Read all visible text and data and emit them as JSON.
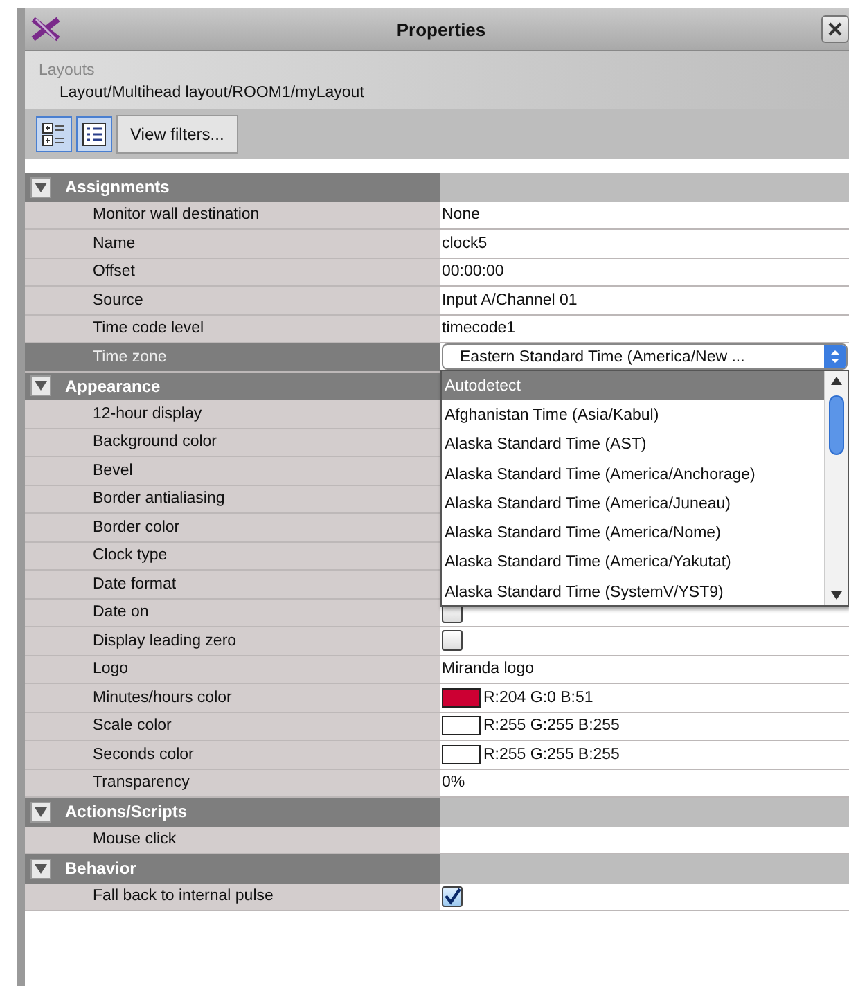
{
  "window": {
    "title": "Properties"
  },
  "location": {
    "label": "Layouts",
    "path": "Layout/Multihead layout/ROOM1/myLayout"
  },
  "toolbar": {
    "icon_buttons": [
      {
        "kind": "categorized"
      },
      {
        "kind": "list"
      }
    ],
    "filter_button": "View filters..."
  },
  "sections": [
    {
      "title": "Assignments",
      "expanded": true,
      "rows": [
        {
          "label": "Monitor wall destination",
          "kind": "text",
          "value": "None",
          "selected": false
        },
        {
          "label": "Name",
          "kind": "text",
          "value": "clock5",
          "selected": false
        },
        {
          "label": "Offset",
          "kind": "text",
          "value": "00:00:00",
          "selected": false
        },
        {
          "label": "Source",
          "kind": "text",
          "value": "Input A/Channel 01",
          "selected": false
        },
        {
          "label": "Time code level",
          "kind": "text",
          "value": "timecode1",
          "selected": false
        },
        {
          "label": "Time zone",
          "kind": "dropdown",
          "value": "Eastern Standard Time (America/New  ...",
          "selected": true,
          "open": true,
          "options": [
            {
              "label": "Autodetect",
              "selected": true
            },
            {
              "label": "Afghanistan Time (Asia/Kabul)",
              "selected": false
            },
            {
              "label": "Alaska Standard Time (AST)",
              "selected": false
            },
            {
              "label": "Alaska Standard Time (America/Anchorage)",
              "selected": false
            },
            {
              "label": "Alaska Standard Time (America/Juneau)",
              "selected": false
            },
            {
              "label": "Alaska Standard Time (America/Nome)",
              "selected": false
            },
            {
              "label": "Alaska Standard Time (America/Yakutat)",
              "selected": false
            },
            {
              "label": "Alaska Standard Time (SystemV/YST9)",
              "selected": false
            }
          ]
        }
      ]
    },
    {
      "title": "Appearance",
      "expanded": true,
      "rows": [
        {
          "label": "12-hour display",
          "kind": "hidden",
          "selected": false
        },
        {
          "label": "Background color",
          "kind": "hidden",
          "selected": false
        },
        {
          "label": "Bevel",
          "kind": "hidden",
          "selected": false
        },
        {
          "label": "Border antialiasing",
          "kind": "hidden",
          "selected": false
        },
        {
          "label": "Border color",
          "kind": "hidden",
          "selected": false
        },
        {
          "label": "Clock type",
          "kind": "hidden",
          "selected": false
        },
        {
          "label": "Date format",
          "kind": "hidden",
          "selected": false
        },
        {
          "label": "Date on",
          "kind": "checkbox",
          "checked": false,
          "selected": false
        },
        {
          "label": "Display leading zero",
          "kind": "checkbox",
          "checked": false,
          "selected": false
        },
        {
          "label": "Logo",
          "kind": "text",
          "value": "Miranda logo",
          "selected": false
        },
        {
          "label": "Minutes/hours color",
          "kind": "color",
          "color": "#cc0033",
          "value": "R:204 G:0 B:51",
          "selected": false
        },
        {
          "label": "Scale color",
          "kind": "color",
          "color": "#ffffff",
          "value": "R:255 G:255 B:255",
          "selected": false
        },
        {
          "label": "Seconds color",
          "kind": "color",
          "color": "#ffffff",
          "value": "R:255 G:255 B:255",
          "selected": false
        },
        {
          "label": "Transparency",
          "kind": "text",
          "value": "0%",
          "selected": false
        }
      ]
    },
    {
      "title": "Actions/Scripts",
      "expanded": true,
      "rows": [
        {
          "label": "Mouse click",
          "kind": "empty",
          "selected": false
        }
      ]
    },
    {
      "title": "Behavior",
      "expanded": true,
      "rows": [
        {
          "label": "Fall back to internal pulse",
          "kind": "checkbox",
          "checked": true,
          "selected": false
        }
      ]
    }
  ]
}
